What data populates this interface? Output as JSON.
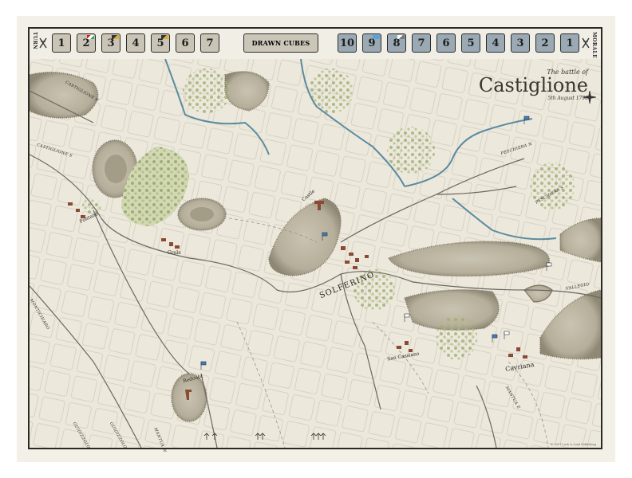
{
  "header": {
    "turn_label": "TURN",
    "morale_label": "MORALE",
    "drawn_cubes_label": "DRAWN CUBES",
    "turn_track": [
      {
        "label": "1",
        "marker": ""
      },
      {
        "label": "2",
        "marker": "red"
      },
      {
        "label": "3",
        "marker": "gold"
      },
      {
        "label": "4",
        "marker": ""
      },
      {
        "label": "5",
        "marker": "gold"
      },
      {
        "label": "6",
        "marker": ""
      },
      {
        "label": "7",
        "marker": ""
      }
    ],
    "morale_track": [
      {
        "label": "10",
        "marker": ""
      },
      {
        "label": "9",
        "marker": "blue"
      },
      {
        "label": "8",
        "marker": "grey"
      },
      {
        "label": "7",
        "marker": ""
      },
      {
        "label": "6",
        "marker": ""
      },
      {
        "label": "5",
        "marker": ""
      },
      {
        "label": "4",
        "marker": ""
      },
      {
        "label": "3",
        "marker": ""
      },
      {
        "label": "2",
        "marker": ""
      },
      {
        "label": "1",
        "marker": ""
      }
    ]
  },
  "title": {
    "pre": "The battle of",
    "main": "Castiglione",
    "date": "5th August 1796"
  },
  "labels": {
    "castiglione_n": "CASTIGLIONE N",
    "castiglione_s": "CASTIGLIONE S",
    "peschiera_n": "PESCHIERA N",
    "peschiera_s": "PESCHIERA S",
    "montichiaro": "MONTICHIARO",
    "vallegio": "VALLEGIO",
    "mantua_e": "MANTUA E",
    "mantua_w": "MANTUA W",
    "guidizzolo_1": "GUIDIZZOLO",
    "guidizzolo_2": "GUIDIZZOLO",
    "solferino": "SOLFERINO",
    "castle": "Castle",
    "fontane": "Fontane",
    "grole": "Grole",
    "redoubt": "Redoubt",
    "san_cassiano": "San Cassiano",
    "cavriana": "Cavriana"
  },
  "footer": {
    "copyright": "© 2017 Lock 'n Load Publishing"
  },
  "colors": {
    "paper": "#ecE8dc",
    "hill": "#b7b19f",
    "river": "#5b8aa0",
    "road": "#6b6760",
    "woods": "#c6cfa3",
    "building": "#8a4a34",
    "austrian_flag": "#3b7fc4",
    "french_flag": "#ffffff"
  }
}
